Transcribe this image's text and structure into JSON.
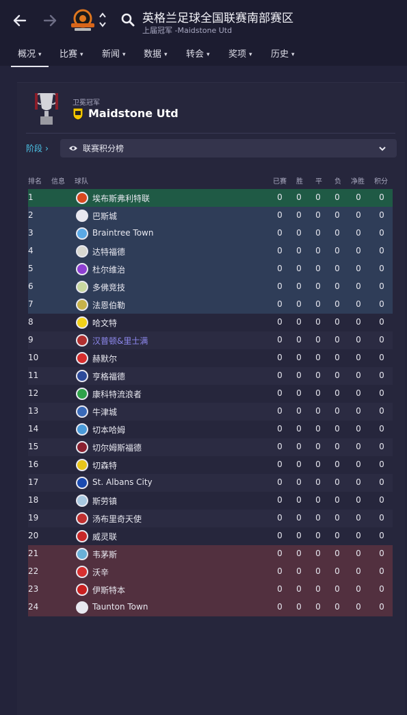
{
  "header": {
    "title": "英格兰足球全国联赛南部赛区",
    "subtitle": "上届冠军 -Maidstone Utd",
    "menu": [
      "概况",
      "比赛",
      "新闻",
      "数据",
      "转会",
      "奖项",
      "历史"
    ]
  },
  "holder": {
    "label": "卫冕冠军",
    "name": "Maidstone Utd"
  },
  "stage": {
    "link": "阶段",
    "selected": "联赛积分榜"
  },
  "table": {
    "headers": [
      "排名",
      "信息",
      "球队",
      "已赛",
      "胜",
      "平",
      "负",
      "净胜",
      "积分"
    ],
    "rows": [
      {
        "pos": "1",
        "team": "埃布斯弗利特联",
        "p": "0",
        "w": "0",
        "d": "0",
        "l": "0",
        "gd": "0",
        "pts": "0"
      },
      {
        "pos": "2",
        "team": "巴斯城",
        "p": "0",
        "w": "0",
        "d": "0",
        "l": "0",
        "gd": "0",
        "pts": "0"
      },
      {
        "pos": "3",
        "team": "Braintree Town",
        "p": "0",
        "w": "0",
        "d": "0",
        "l": "0",
        "gd": "0",
        "pts": "0"
      },
      {
        "pos": "4",
        "team": "达特福德",
        "p": "0",
        "w": "0",
        "d": "0",
        "l": "0",
        "gd": "0",
        "pts": "0"
      },
      {
        "pos": "5",
        "team": "杜尔维治",
        "p": "0",
        "w": "0",
        "d": "0",
        "l": "0",
        "gd": "0",
        "pts": "0"
      },
      {
        "pos": "6",
        "team": "多佛竞技",
        "p": "0",
        "w": "0",
        "d": "0",
        "l": "0",
        "gd": "0",
        "pts": "0"
      },
      {
        "pos": "7",
        "team": "法恩伯勒",
        "p": "0",
        "w": "0",
        "d": "0",
        "l": "0",
        "gd": "0",
        "pts": "0"
      },
      {
        "pos": "8",
        "team": "哈文特",
        "p": "0",
        "w": "0",
        "d": "0",
        "l": "0",
        "gd": "0",
        "pts": "0"
      },
      {
        "pos": "9",
        "team": "汉普顿&里士满",
        "p": "0",
        "w": "0",
        "d": "0",
        "l": "0",
        "gd": "0",
        "pts": "0"
      },
      {
        "pos": "10",
        "team": "赫默尔",
        "p": "0",
        "w": "0",
        "d": "0",
        "l": "0",
        "gd": "0",
        "pts": "0"
      },
      {
        "pos": "11",
        "team": "亨格福德",
        "p": "0",
        "w": "0",
        "d": "0",
        "l": "0",
        "gd": "0",
        "pts": "0"
      },
      {
        "pos": "12",
        "team": "康科特流浪者",
        "p": "0",
        "w": "0",
        "d": "0",
        "l": "0",
        "gd": "0",
        "pts": "0"
      },
      {
        "pos": "13",
        "team": "牛津城",
        "p": "0",
        "w": "0",
        "d": "0",
        "l": "0",
        "gd": "0",
        "pts": "0"
      },
      {
        "pos": "14",
        "team": "切本哈姆",
        "p": "0",
        "w": "0",
        "d": "0",
        "l": "0",
        "gd": "0",
        "pts": "0"
      },
      {
        "pos": "15",
        "team": "切尔姆斯福德",
        "p": "0",
        "w": "0",
        "d": "0",
        "l": "0",
        "gd": "0",
        "pts": "0"
      },
      {
        "pos": "16",
        "team": "切森特",
        "p": "0",
        "w": "0",
        "d": "0",
        "l": "0",
        "gd": "0",
        "pts": "0"
      },
      {
        "pos": "17",
        "team": "St. Albans City",
        "p": "0",
        "w": "0",
        "d": "0",
        "l": "0",
        "gd": "0",
        "pts": "0"
      },
      {
        "pos": "18",
        "team": "斯劳镇",
        "p": "0",
        "w": "0",
        "d": "0",
        "l": "0",
        "gd": "0",
        "pts": "0"
      },
      {
        "pos": "19",
        "team": "汤布里奇天使",
        "p": "0",
        "w": "0",
        "d": "0",
        "l": "0",
        "gd": "0",
        "pts": "0"
      },
      {
        "pos": "20",
        "team": "威灵联",
        "p": "0",
        "w": "0",
        "d": "0",
        "l": "0",
        "gd": "0",
        "pts": "0"
      },
      {
        "pos": "21",
        "team": "韦茅斯",
        "p": "0",
        "w": "0",
        "d": "0",
        "l": "0",
        "gd": "0",
        "pts": "0"
      },
      {
        "pos": "22",
        "team": "沃辛",
        "p": "0",
        "w": "0",
        "d": "0",
        "l": "0",
        "gd": "0",
        "pts": "0"
      },
      {
        "pos": "23",
        "team": "伊斯特本",
        "p": "0",
        "w": "0",
        "d": "0",
        "l": "0",
        "gd": "0",
        "pts": "0"
      },
      {
        "pos": "24",
        "team": "Taunton Town",
        "p": "0",
        "w": "0",
        "d": "0",
        "l": "0",
        "gd": "0",
        "pts": "0"
      }
    ]
  },
  "colors": {
    "champion_row": "#1f5a45",
    "playoff_row": "#2f3d58",
    "relegation_row": "#52303f",
    "row_even": "#26263c",
    "row_odd": "#2b2b42",
    "highlight_team_text": "#8e88ee",
    "accent": "#4cc3e6"
  }
}
